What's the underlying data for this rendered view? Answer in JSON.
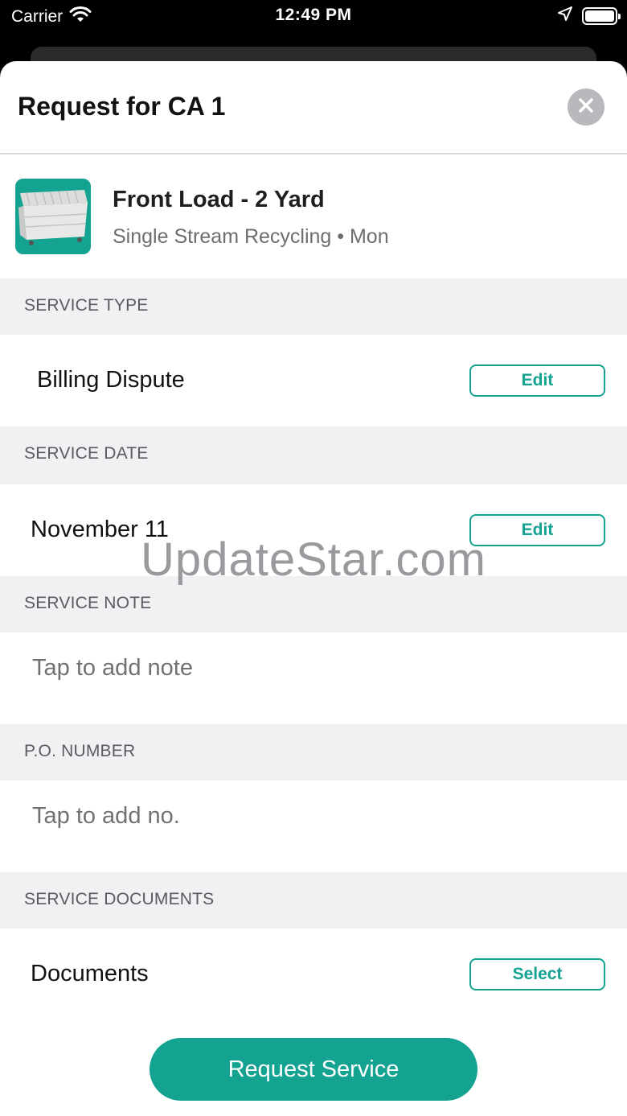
{
  "status_bar": {
    "carrier": "Carrier",
    "time": "12:49 PM"
  },
  "sheet": {
    "title": "Request for CA 1"
  },
  "product": {
    "name": "Front Load - 2 Yard",
    "subtitle": "Single Stream Recycling • Mon",
    "image_bg": "#14a291"
  },
  "sections": {
    "service_type": {
      "header": "SERVICE TYPE",
      "value": "Billing Dispute",
      "button": "Edit"
    },
    "service_date": {
      "header": "SERVICE DATE",
      "value": "November 11",
      "button": "Edit"
    },
    "service_note": {
      "header": "SERVICE NOTE",
      "placeholder": "Tap to add note"
    },
    "po_number": {
      "header": "P.O. NUMBER",
      "placeholder": "Tap to add no."
    },
    "service_documents": {
      "header": "SERVICE DOCUMENTS",
      "value": "Documents",
      "button": "Select"
    }
  },
  "primary_button": "Request Service",
  "watermark": "UpdateStar.com",
  "colors": {
    "accent": "#14a291",
    "section_bg": "#f1f1f4"
  },
  "icons": [
    "wifi-icon",
    "location-arrow-icon",
    "battery-icon",
    "close-icon",
    "dumpster-icon"
  ]
}
